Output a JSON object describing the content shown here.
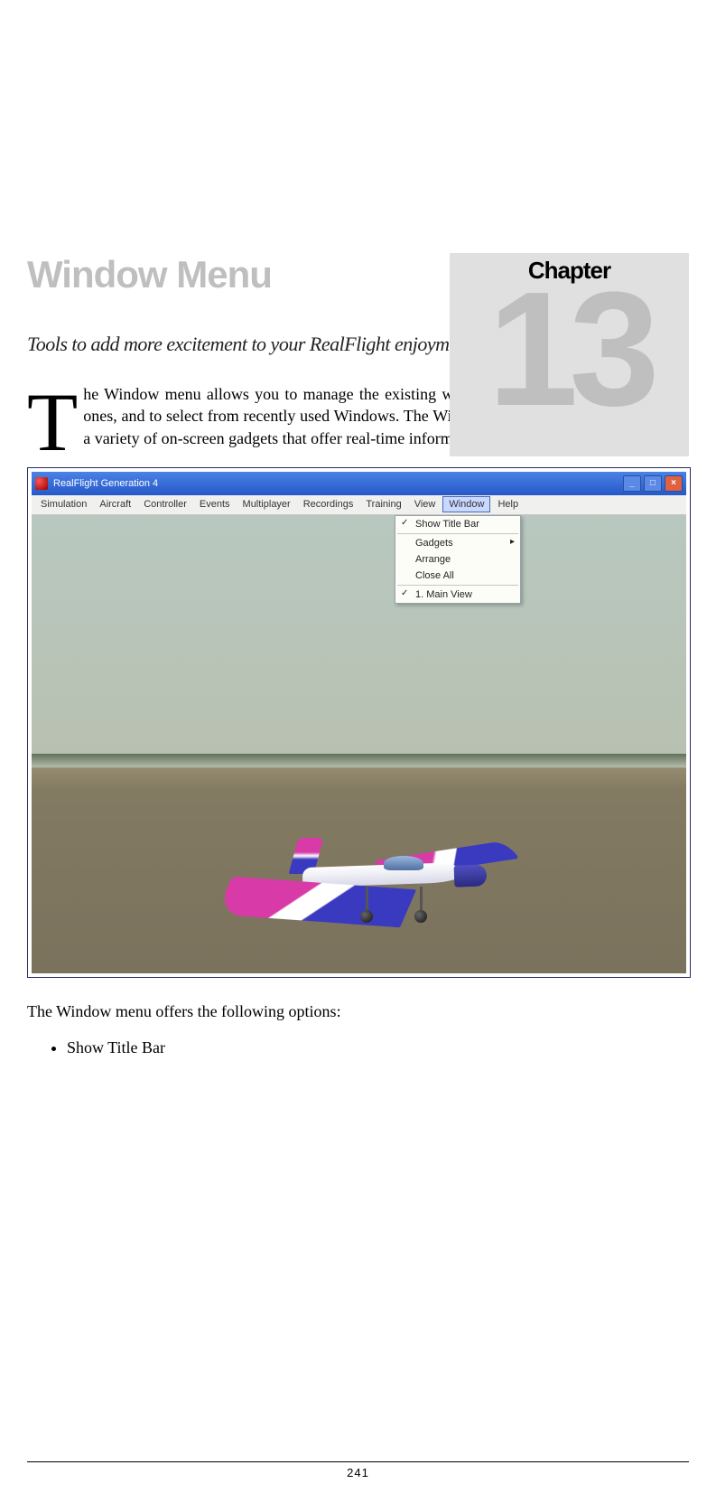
{
  "chapter": {
    "label": "Chapter",
    "number": "13"
  },
  "heading": "Window Menu",
  "subtitle": "Tools to add more excitement to your RealFlight enjoyment.",
  "intro": {
    "dropcap": "T",
    "rest": "he Window menu allows you to manage the existing windows or viewports, to create new ones, and to select from recently used Windows.  The Window menu also gives you access to a variety of on-screen gadgets that offer real-time information about your current flight."
  },
  "screenshot": {
    "titlebar": {
      "app_title": "RealFlight Generation 4",
      "btn_min": "_",
      "btn_max": "□",
      "btn_close": "×"
    },
    "menubar": {
      "items": [
        "Simulation",
        "Aircraft",
        "Controller",
        "Events",
        "Multiplayer",
        "Recordings",
        "Training",
        "View",
        "Window",
        "Help"
      ],
      "active_index": 8
    },
    "dropdown": {
      "items": [
        {
          "label": "Show Title Bar",
          "checked": true,
          "sep_after": true
        },
        {
          "label": "Gadgets",
          "submenu": true
        },
        {
          "label": "Arrange"
        },
        {
          "label": "Close All",
          "sep_after": true
        },
        {
          "label": "1. Main View",
          "checked": true
        }
      ]
    }
  },
  "after_shot_text": "The Window menu offers the following options:",
  "options_list": [
    "Show Title Bar"
  ],
  "footer": {
    "page_number": "241"
  }
}
